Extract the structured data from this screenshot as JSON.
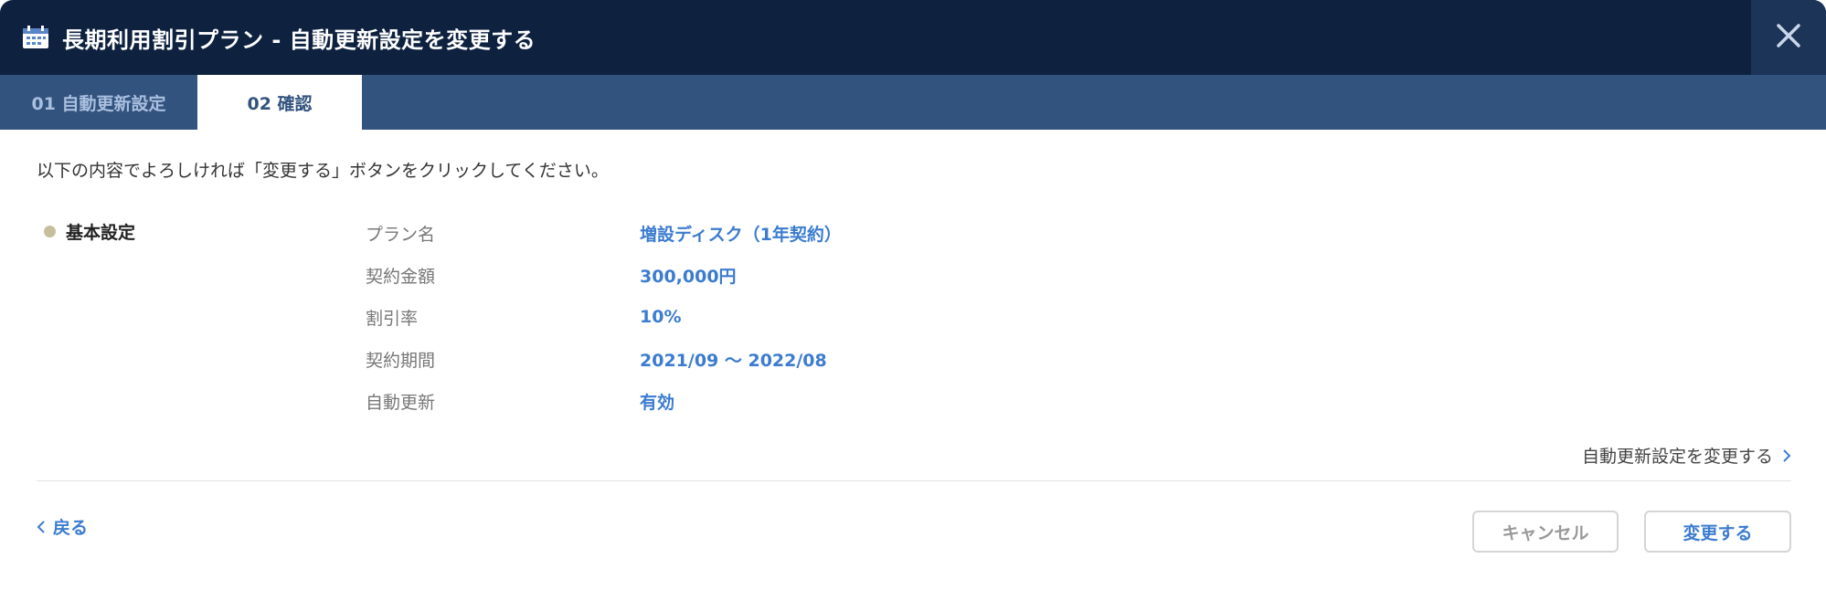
{
  "header": {
    "title": "長期利用割引プラン - 自動更新設定を変更する",
    "icon": "calendar-icon",
    "close_icon": "close-icon"
  },
  "tabs": [
    {
      "label": "01 自動更新設定",
      "active": false
    },
    {
      "label": "02 確認",
      "active": true
    }
  ],
  "main": {
    "instruction": "以下の内容でよろしければ「変更する」ボタンをクリックしてください。",
    "section_label": "基本設定",
    "rows": [
      {
        "label": "プラン名",
        "value": "増設ディスク（1年契約）"
      },
      {
        "label": "契約金額",
        "value": "300,000円"
      },
      {
        "label": "割引率",
        "value": "10%"
      },
      {
        "label": "契約期間",
        "value": "2021/09 〜 2022/08"
      },
      {
        "label": "自動更新",
        "value": "有効"
      }
    ],
    "change_link": "自動更新設定を変更する"
  },
  "footer": {
    "back_label": "戻る",
    "cancel_label": "キャンセル",
    "submit_label": "変更する"
  },
  "colors": {
    "header_bg": "#0e2240",
    "tabbar_bg": "#33537f",
    "accent": "#3c7ccf",
    "dot": "#c7bf9c"
  }
}
